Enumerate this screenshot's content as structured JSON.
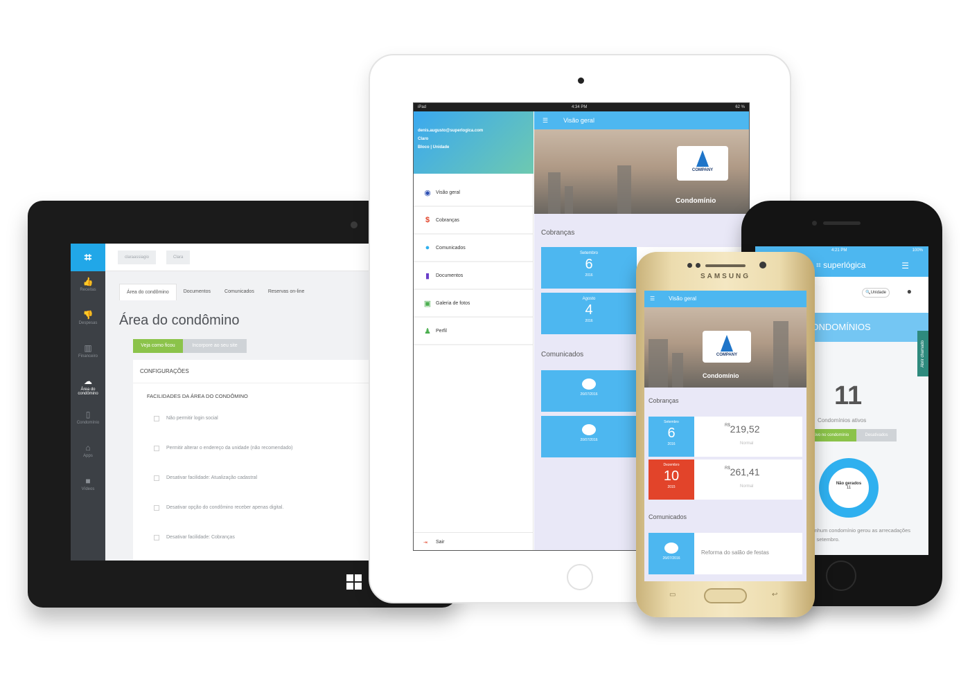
{
  "colors": {
    "accent": "#4db7f0",
    "green": "#8bc34a",
    "red": "#e2442a",
    "dark": "#3c4045"
  },
  "windows_app": {
    "breadcrumbs": [
      "claraassiagio",
      "Clara"
    ],
    "sidebar": [
      {
        "label": "Receitas",
        "icon": "thumb-up-icon"
      },
      {
        "label": "Despesas",
        "icon": "thumb-down-icon"
      },
      {
        "label": "Financeiro",
        "icon": "bar-chart-icon"
      },
      {
        "label": "Área do condômino",
        "icon": "cloud-icon",
        "active": true
      },
      {
        "label": "Condomínio",
        "icon": "phone-icon"
      },
      {
        "label": "Apps",
        "icon": "home-icon"
      },
      {
        "label": "Vídeos",
        "icon": "video-icon"
      }
    ],
    "tabs": [
      "Área do condômino",
      "Documentos",
      "Comunicados",
      "Reservas on-line"
    ],
    "title": "Área do condômino",
    "btn_primary": "Veja como ficou",
    "btn_secondary": "Incorpore ao seu site",
    "config_title": "CONFIGURAÇÕES",
    "section_title": "FACILIDADES DA ÁREA DO CONDÔMINO",
    "options": [
      "Não permitir login social",
      "Permitir alterar o endereço da unidade (não recomendado)",
      "Desativar facilidade: Atualização cadastral",
      "Desativar opção do condômino receber apenas digital.",
      "Desativar facilidade: Cobranças"
    ]
  },
  "ipad_app": {
    "status_left": "iPad",
    "status_time": "4:34 PM",
    "status_battery": "62 %",
    "user_email": "denis.augusto@superlogica.com",
    "user_name": "Claro",
    "user_unit": "Bloco | Unidade",
    "menu": [
      {
        "label": "Visão geral",
        "icon": "eye-icon"
      },
      {
        "label": "Cobranças",
        "icon": "dollar-icon"
      },
      {
        "label": "Comunicados",
        "icon": "chat-icon"
      },
      {
        "label": "Documentos",
        "icon": "document-icon"
      },
      {
        "label": "Galeria de fotos",
        "icon": "gallery-icon"
      },
      {
        "label": "Perfil",
        "icon": "user-icon"
      }
    ],
    "exit_label": "Sair",
    "header_title": "Visão geral",
    "company": "COMPANY",
    "condo_name": "Condomínio",
    "charges_title": "Cobranças",
    "charges": [
      {
        "month": "Setembro",
        "day": "6",
        "year": "2016"
      },
      {
        "month": "Agosto",
        "day": "4",
        "year": "2016"
      }
    ],
    "messages_title": "Comunicados",
    "messages": [
      {
        "date": "26/07/2016"
      },
      {
        "date": "20/07/2016"
      }
    ]
  },
  "samsung_app": {
    "brand": "SAMSUNG",
    "header_title": "Visão geral",
    "company": "COMPANY",
    "condo_name": "Condomínio",
    "charges_title": "Cobranças",
    "charges": [
      {
        "month": "Setembro",
        "day": "6",
        "year": "2016",
        "currency": "R$",
        "amount": "219,52",
        "status": "Normal",
        "color": "#4db7f0"
      },
      {
        "month": "Dezembro",
        "day": "10",
        "year": "2015",
        "currency": "R$",
        "amount": "261,41",
        "status": "Normal",
        "color": "#e2442a"
      }
    ],
    "messages_title": "Comunicados",
    "message": {
      "date": "26/07/2016",
      "text": "Reforma do salão de festas"
    }
  },
  "iphone_app": {
    "status_time": "4:21 PM",
    "status_battery": "100%",
    "brand": "superlógica",
    "search_label": "Unidade",
    "banner": "CONDOMÍNIOS",
    "side_button": "Abrir chamado",
    "count": "11",
    "count_label": "Condomínios ativos",
    "tab_active": "Ativo no condomínio",
    "tab_inactive": "Desativados",
    "donut_label": "Não gerados",
    "donut_value": "11",
    "footer": "Nenhum condomínio gerou as arrecadações em setembro."
  }
}
